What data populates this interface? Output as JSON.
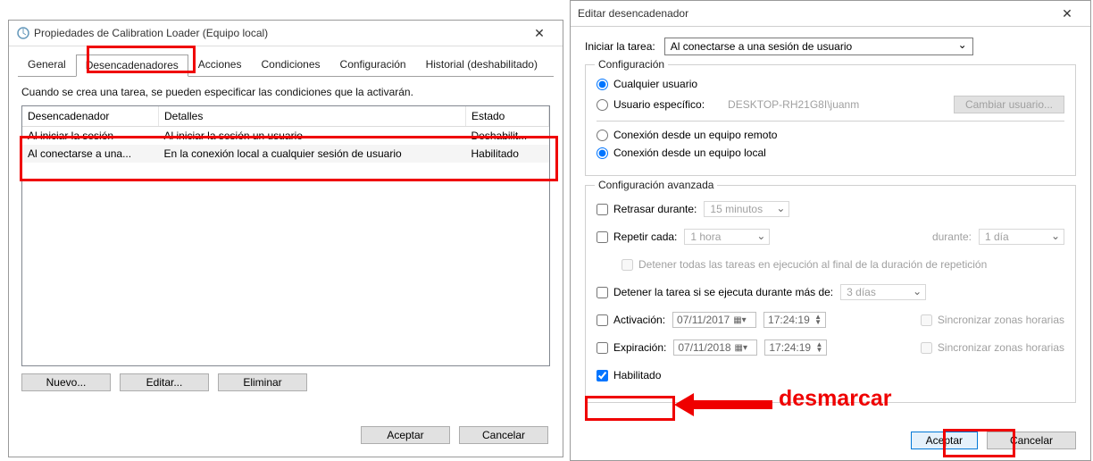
{
  "left": {
    "title": "Propiedades de Calibration Loader (Equipo local)",
    "tabs": {
      "general": "General",
      "triggers": "Desencadenadores",
      "actions": "Acciones",
      "conditions": "Condiciones",
      "config": "Configuración",
      "history": "Historial (deshabilitado)"
    },
    "hint": "Cuando se crea una tarea, se pueden especificar las condiciones que la activarán.",
    "columns": {
      "trigger": "Desencadenador",
      "details": "Detalles",
      "state": "Estado"
    },
    "rows": [
      {
        "trigger": "Al iniciar la sesión",
        "details": "Al iniciar la sesión un usuario",
        "state": "Deshabilit..."
      },
      {
        "trigger": "Al conectarse a una...",
        "details": "En la conexión local a cualquier sesión de usuario",
        "state": "Habilitado"
      }
    ],
    "buttons": {
      "new": "Nuevo...",
      "edit": "Editar...",
      "delete": "Eliminar",
      "ok": "Aceptar",
      "cancel": "Cancelar"
    }
  },
  "right": {
    "title": "Editar desencadenador",
    "begin_label": "Iniciar la tarea:",
    "begin_value": "Al conectarse a una sesión de usuario",
    "config_legend": "Configuración",
    "radio_any": "Cualquier usuario",
    "radio_specific": "Usuario específico:",
    "specific_value": "DESKTOP-RH21G8I\\juanm",
    "change_user": "Cambiar usuario...",
    "radio_remote": "Conexión desde un equipo remoto",
    "radio_local": "Conexión desde un equipo local",
    "adv_legend": "Configuración avanzada",
    "delay_label": "Retrasar durante:",
    "delay_value": "15 minutos",
    "repeat_label": "Repetir cada:",
    "repeat_value": "1 hora",
    "durante": "durante:",
    "durante_value": "1 día",
    "stop_all": "Detener todas las tareas en ejecución al final de la duración de repetición",
    "stop_if": "Detener la tarea si se ejecuta durante más de:",
    "stop_if_value": "3 días",
    "activate": "Activación:",
    "activate_date": "07/11/2017",
    "activate_time": "17:24:19",
    "expire": "Expiración:",
    "expire_date": "07/11/2018",
    "expire_time": "17:24:19",
    "sync": "Sincronizar zonas horarias",
    "enabled": "Habilitado",
    "ok": "Aceptar",
    "cancel": "Cancelar"
  },
  "annotation_text": "desmarcar"
}
